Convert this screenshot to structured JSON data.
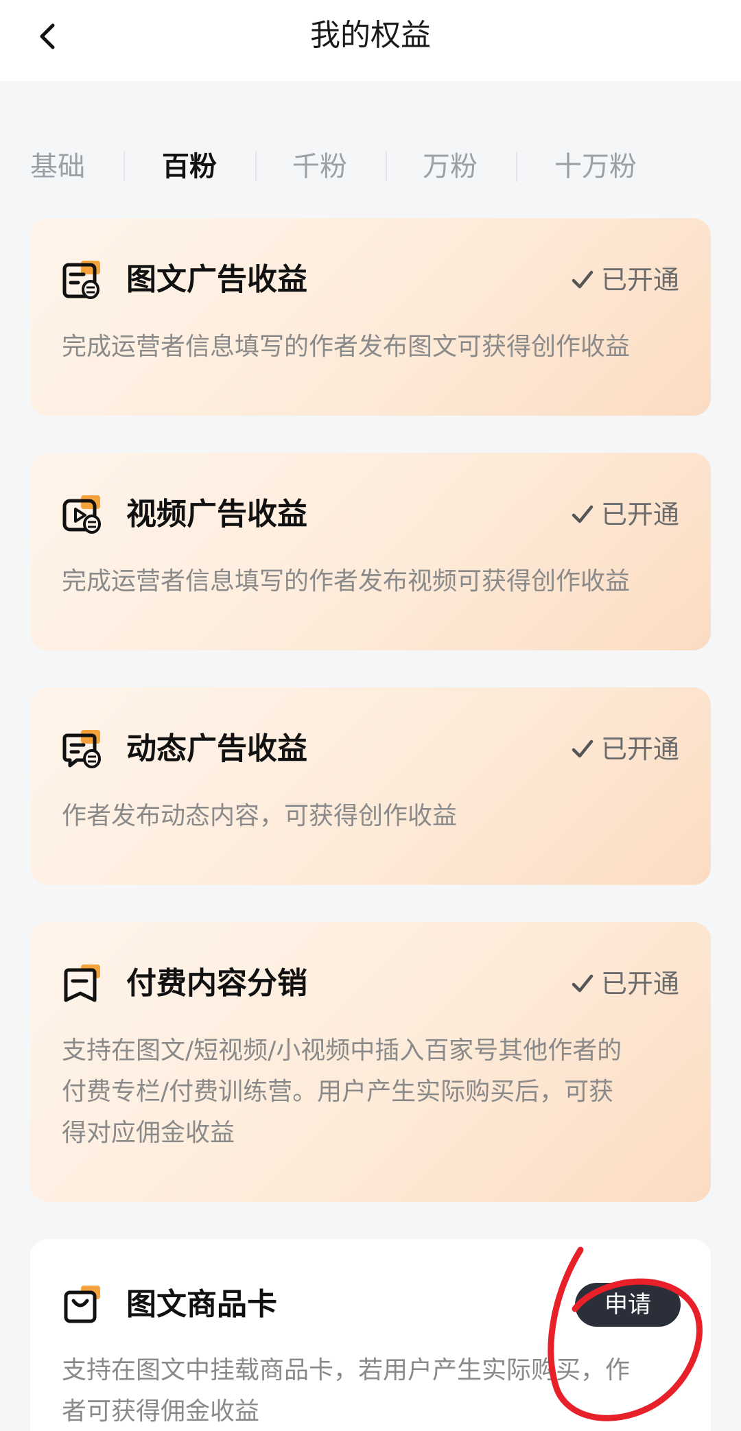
{
  "header": {
    "title": "我的权益"
  },
  "tabs": [
    {
      "label": "基础",
      "active": false
    },
    {
      "label": "百粉",
      "active": true
    },
    {
      "label": "千粉",
      "active": false
    },
    {
      "label": "万粉",
      "active": false
    },
    {
      "label": "十万粉",
      "active": false
    }
  ],
  "cards": [
    {
      "icon": "image-text-ad-icon",
      "title": "图文广告收益",
      "status": "已开通",
      "description": "完成运营者信息填写的作者发布图文可获得创作收益"
    },
    {
      "icon": "video-ad-icon",
      "title": "视频广告收益",
      "status": "已开通",
      "description": "完成运营者信息填写的作者发布视频可获得创作收益"
    },
    {
      "icon": "dynamic-ad-icon",
      "title": "动态广告收益",
      "status": "已开通",
      "description": "作者发布动态内容，可获得创作收益"
    },
    {
      "icon": "paid-content-icon",
      "title": "付费内容分销",
      "status": "已开通",
      "description_lines": [
        "支持在图文/短视频/小视频中插入百家号其他作者的",
        "付费专栏/付费训练营。用户产生实际购买后，可获",
        "得对应佣金收益"
      ]
    },
    {
      "icon": "shopping-bag-icon",
      "title": "图文商品卡",
      "button": "申请",
      "description_lines": [
        "支持在图文中挂载商品卡，若用户产生实际购买，作",
        "者可获得佣金收益"
      ]
    }
  ],
  "colors": {
    "accent_orange": "#f4a23c",
    "card_gradient_start": "#fff5ec",
    "card_gradient_end": "#fbdcc2",
    "apply_button": "#2a2f3a",
    "annotation_red": "#e8202a"
  }
}
